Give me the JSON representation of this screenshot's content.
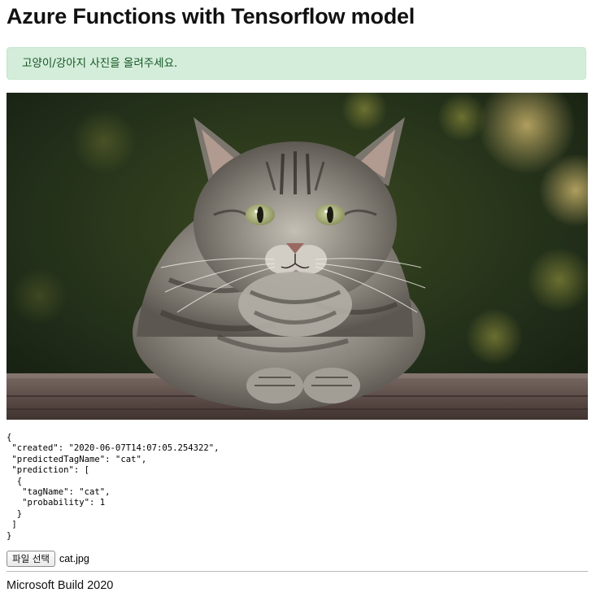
{
  "header": {
    "title": "Azure Functions with Tensorflow model"
  },
  "alert": {
    "message": "고양이/강아지 사진을 올려주세요."
  },
  "image": {
    "subject": "tabby cat lying on wooden bench",
    "icon": "uploaded-photo"
  },
  "result": {
    "json_text": "{\n \"created\": \"2020-06-07T14:07:05.254322\",\n \"predictedTagName\": \"cat\",\n \"prediction\": [\n  {\n   \"tagName\": \"cat\",\n   \"probability\": 1\n  }\n ]\n}"
  },
  "upload": {
    "button_label": "파일 선택",
    "file_name": "cat.jpg"
  },
  "footer": {
    "text": "Microsoft Build 2020"
  },
  "colors": {
    "alert_bg": "#d4edda",
    "alert_border": "#c3e6cb",
    "alert_text": "#155724"
  }
}
